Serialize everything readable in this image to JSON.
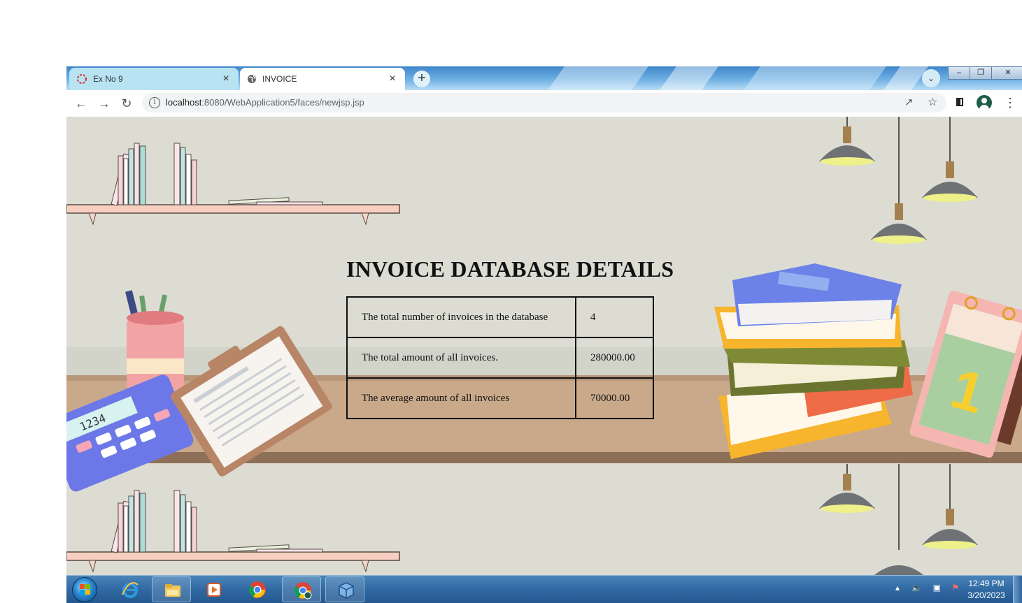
{
  "browser": {
    "tabs": [
      {
        "title": "Ex No 9",
        "active": false
      },
      {
        "title": "INVOICE",
        "active": true
      }
    ],
    "new_tab_label": "+",
    "tab_close_label": "×",
    "url_host": "localhost",
    "url_rest": ":8080/WebApplication5/faces/newjsp.jsp"
  },
  "page": {
    "heading": "INVOICE DATABASE DETAILS",
    "rows": [
      {
        "label": "The total number of invoices in the database",
        "value": "4"
      },
      {
        "label": "The total amount of all invoices.",
        "value": "280000.00"
      },
      {
        "label": "The average amount of all invoices",
        "value": "70000.00"
      }
    ]
  },
  "taskbar": {
    "time": "12:49 PM",
    "date": "3/20/2023",
    "apps": [
      "internet-explorer",
      "file-explorer",
      "media-player",
      "chrome",
      "chrome-profile",
      "virtualbox"
    ]
  },
  "colors": {
    "wall": "#dcdcd2",
    "desk": "#c9a98a",
    "accent_tab": "#b8e3f2"
  }
}
